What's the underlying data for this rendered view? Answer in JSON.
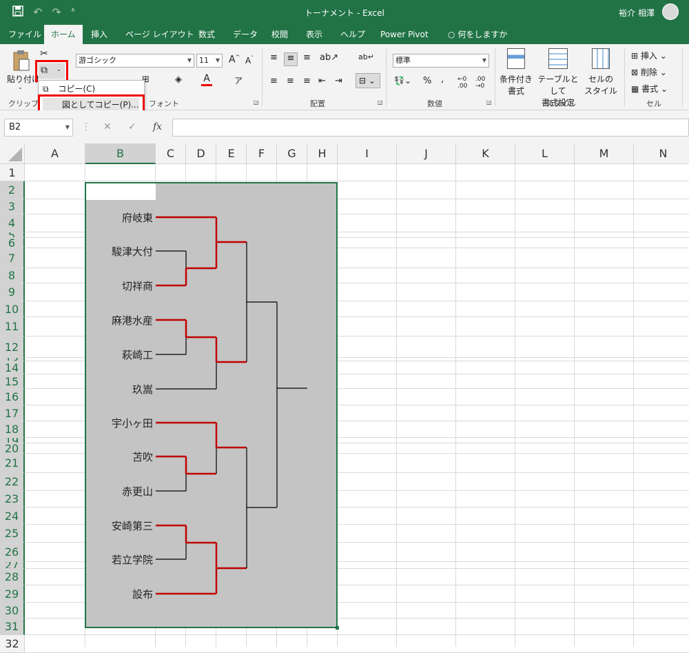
{
  "titlebar": {
    "title": "トーナメント  -  Excel",
    "user": "裕介 相澤",
    "bg_color": "#217346"
  },
  "qat": {
    "save_icon": "save-icon",
    "undo_icon": "undo-icon",
    "redo_icon": "redo-icon",
    "customize_icon": "customize-icon"
  },
  "tabs": [
    "ファイル",
    "ホーム",
    "挿入",
    "ページ レイアウト",
    "数式",
    "データ",
    "校閲",
    "表示",
    "ヘルプ",
    "Power Pivot"
  ],
  "tell_me": "何をしますか",
  "ribbon": {
    "clipboard": {
      "paste": "貼り付け",
      "group": "クリップボ"
    },
    "font": {
      "font_name": "游ゴシック",
      "font_size": "11",
      "group": "フォント"
    },
    "alignment": {
      "group": "配置"
    },
    "number": {
      "format": "標準",
      "group": "数値"
    },
    "styles": {
      "conditional": [
        "条件付き",
        "書式"
      ],
      "table": [
        "テーブルとして",
        "書式設定"
      ],
      "cell": [
        "セルの",
        "スタイル"
      ],
      "group": "スタイル"
    },
    "cells": {
      "insert": "挿入",
      "delete": "削除",
      "format": "書式",
      "group": "セル"
    }
  },
  "copy_menu": {
    "copy": "コピー(C)",
    "copy_as_picture": "図としてコピー(P)..."
  },
  "formula_bar": {
    "name_box": "B2",
    "formula": ""
  },
  "columns": [
    "A",
    "B",
    "C",
    "D",
    "E",
    "F",
    "G",
    "H",
    "I",
    "J",
    "K",
    "L",
    "M",
    "N"
  ],
  "rows": [
    "1",
    "2",
    "3",
    "4",
    "5",
    "6",
    "7",
    "8",
    "9",
    "10",
    "11",
    "12",
    "13",
    "14",
    "15",
    "16",
    "17",
    "18",
    "19",
    "20",
    "21",
    "22",
    "23",
    "24",
    "25",
    "26",
    "27",
    "28",
    "29",
    "30",
    "31",
    "32"
  ],
  "selected_cell": "B2",
  "tournament": {
    "teams": [
      "府岐東",
      "駿津大付",
      "切祥商",
      "麻港水産",
      "萩崎工",
      "玖嵩",
      "宇小ヶ田",
      "苫吹",
      "赤更山",
      "安崎第三",
      "若立学院",
      "設布"
    ],
    "winner_line_color": "#c00000",
    "loser_line_color": "#000000",
    "picture_bg": "#c4c4c4"
  }
}
